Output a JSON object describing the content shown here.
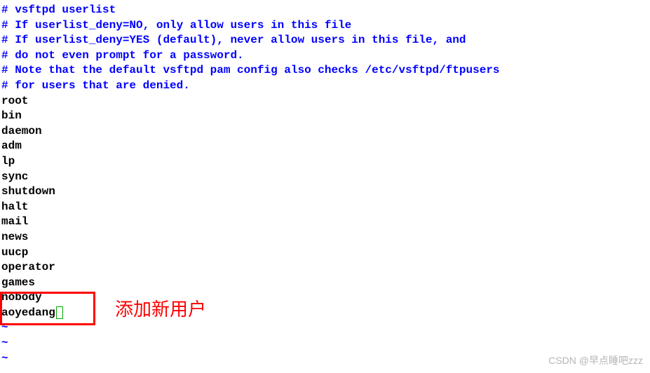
{
  "editor": {
    "comments": [
      "# vsftpd userlist",
      "# If userlist_deny=NO, only allow users in this file",
      "# If userlist_deny=YES (default), never allow users in this file, and",
      "# do not even prompt for a password.",
      "# Note that the default vsftpd pam config also checks /etc/vsftpd/ftpusers",
      "# for users that are denied."
    ],
    "users": [
      "root",
      "bin",
      "daemon",
      "adm",
      "lp",
      "sync",
      "shutdown",
      "halt",
      "mail",
      "news",
      "uucp",
      "operator",
      "games",
      "nobody"
    ],
    "new_user": "aoyedang",
    "tilde": "~",
    "empty_lines": 3
  },
  "annotation": {
    "label": "添加新用户"
  },
  "watermark": "CSDN @早点睡吧zzz"
}
